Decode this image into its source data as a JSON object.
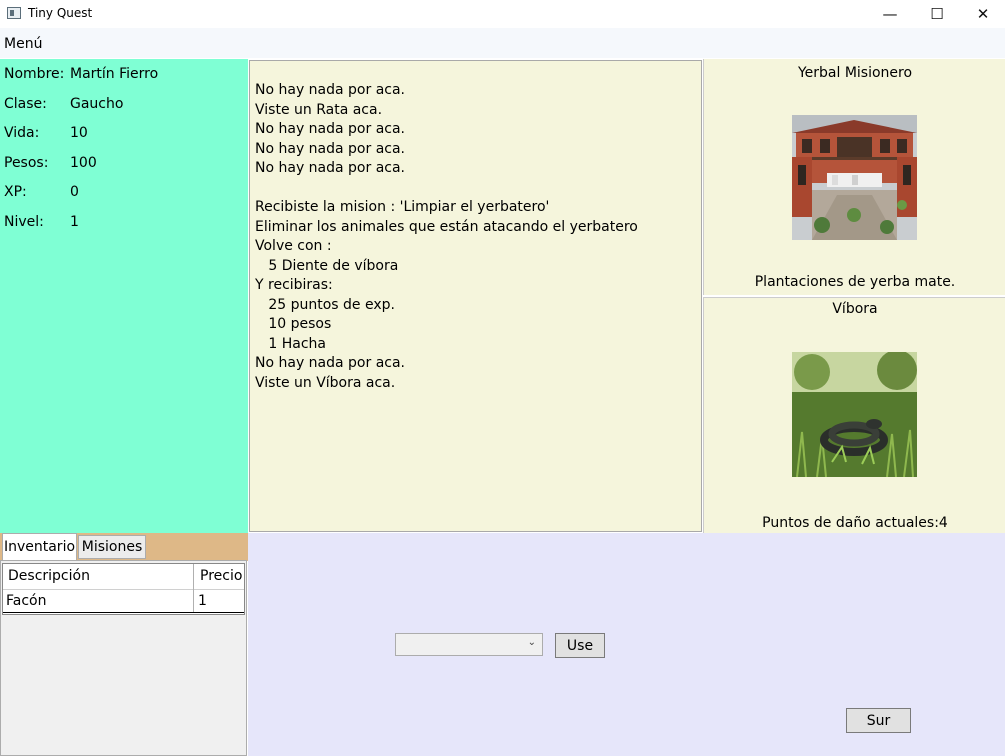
{
  "window": {
    "title": "Tiny Quest"
  },
  "menu": {
    "item": "Menú"
  },
  "stats": [
    {
      "label": "Nombre:",
      "value": "Martín Fierro"
    },
    {
      "label": "Clase:",
      "value": "Gaucho"
    },
    {
      "label": "Vida:",
      "value": "10"
    },
    {
      "label": "Pesos:",
      "value": "100"
    },
    {
      "label": "XP:",
      "value": "0"
    },
    {
      "label": "Nivel:",
      "value": "1"
    }
  ],
  "log": "No hay nada por aca.\nViste un Rata aca.\nNo hay nada por aca.\nNo hay nada por aca.\nNo hay nada por aca.\n\nRecibiste la mision : 'Limpiar el yerbatero'\nEliminar los animales que están atacando el yerbatero\nVolve con :\n   5 Diente de víbora\nY recibiras:\n   25 puntos de exp.\n   10 pesos\n   1 Hacha\nNo hay nada por aca.\nViste un Víbora aca.",
  "location": {
    "name": "Yerbal Misionero",
    "description": "Plantaciones de yerba mate."
  },
  "monster": {
    "name": "Víbora",
    "description": "Puntos de daño actuales:4"
  },
  "tabs": {
    "inventory": "Inventario",
    "quests": "Misiones"
  },
  "inventory": {
    "columns": {
      "description": "Descripción",
      "price": "Precio"
    },
    "rows": [
      {
        "description": "Facón",
        "price": "1"
      }
    ]
  },
  "actions": {
    "combo_value": "",
    "use_label": "Use",
    "south_label": "Sur"
  },
  "icons": {
    "minimize": "minimize-icon",
    "maximize": "maximize-icon",
    "close": "close-icon",
    "dropdown": "chevron-down-icon"
  }
}
